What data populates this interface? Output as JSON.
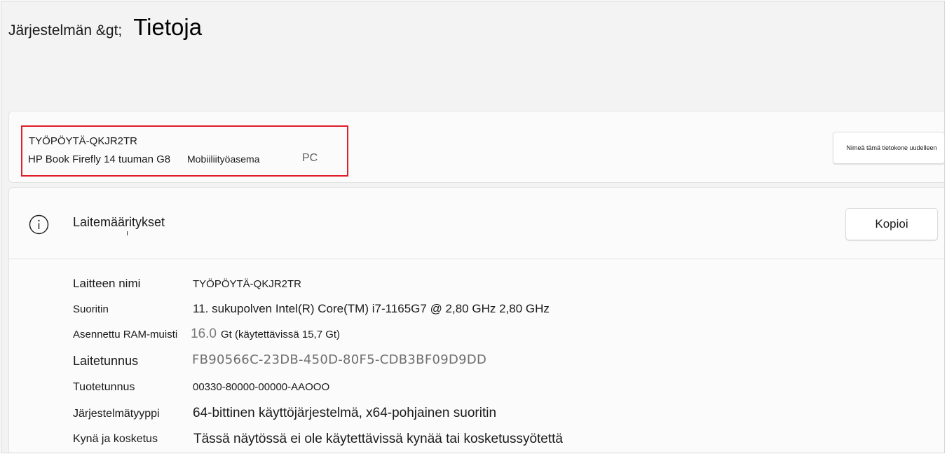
{
  "breadcrumb": {
    "parent": "Järjestelmän &gt;",
    "current": "Tietoja"
  },
  "device": {
    "name": "TYÖPÖYTÄ-QKJR2TR",
    "model": "HP Book Firefly 14 tuuman G8",
    "type": "Mobiiliityöasema",
    "form_factor": "PC",
    "rename_label": "Nimeä tämä tietokone uudelleen",
    "highlight_color": "#e01e2a"
  },
  "specs": {
    "title": "Laitemääritykset",
    "icon": "info-icon",
    "copy_label": "Kopioi",
    "rows": [
      {
        "label": "Laitteen nimi",
        "value": "TYÖPÖYTÄ-QKJR2TR"
      },
      {
        "label": "Suoritin",
        "value": "11. sukupolven Intel(R) Core(TM) i7-1165G7 @ 2,80 GHz 2,80 GHz"
      },
      {
        "label": "Asennettu  RAM-muisti",
        "value_number": "16.0",
        "value_rest": "Gt (käytettävissä 15,7 Gt)"
      },
      {
        "label": "Laitetunnus",
        "value": "FB90566C-23DB-450D-80F5-CDB3BF09D9DD"
      },
      {
        "label": "Tuotetunnus",
        "value": "00330-80000-00000-AAOOO"
      },
      {
        "label": "Järjestelmätyyppi",
        "value": "64-bittinen käyttöjärjestelmä, x64-pohjainen suoritin"
      },
      {
        "label": "Kynä ja kosketus",
        "value": "Tässä näytössä ei ole käytettävissä kynää tai kosketussyötettä"
      }
    ]
  }
}
